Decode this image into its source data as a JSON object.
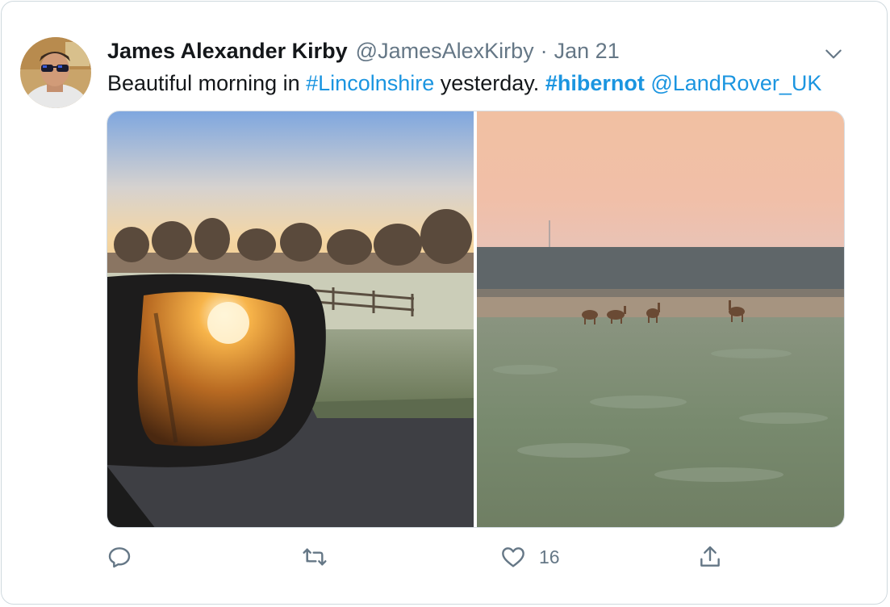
{
  "tweet": {
    "author_name": "James Alexander Kirby",
    "author_handle": "@JamesAlexKirby",
    "separator": "·",
    "date": "Jan 21",
    "text_plain_1": "Beautiful morning in ",
    "hashtag_1": "#Lincolnshire",
    "text_plain_2": " yesterday. ",
    "hashtag_2": "#hibernot",
    "text_plain_3": " ",
    "mention": "@LandRover_UK"
  },
  "actions": {
    "reply": {
      "icon": "reply-icon",
      "count": ""
    },
    "retweet": {
      "icon": "retweet-icon",
      "count": ""
    },
    "like": {
      "icon": "heart-icon",
      "count": "16"
    },
    "share": {
      "icon": "share-icon",
      "count": ""
    }
  },
  "media": [
    {
      "icon": "photo-sunrise-mirror"
    },
    {
      "icon": "photo-deer-field"
    }
  ],
  "colors": {
    "link": "#1b95e0",
    "secondary_text": "#657786",
    "border": "#cfd9de"
  }
}
